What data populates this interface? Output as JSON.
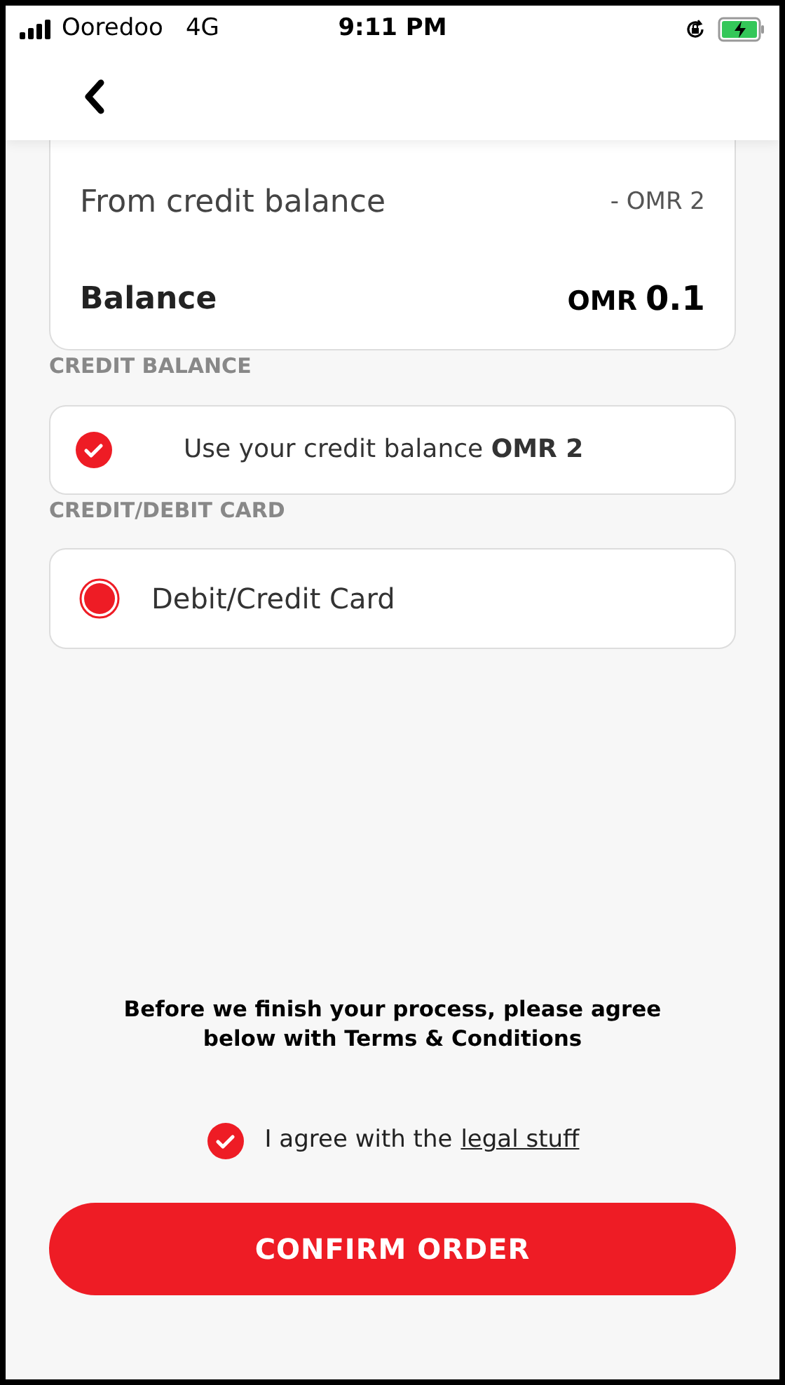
{
  "status_bar": {
    "carrier": "Ooredoo",
    "network": "4G",
    "time": "9:11 PM"
  },
  "summary": {
    "rows": [
      {
        "kind": "line",
        "label": "From credit balance",
        "value": "- OMR 2"
      },
      {
        "kind": "total",
        "label": "Balance",
        "currency": "OMR",
        "value": "0.1"
      }
    ]
  },
  "sections": [
    {
      "heading": "CREDIT BALANCE",
      "option": {
        "kind": "checkbox",
        "checked": true,
        "text": "Use your credit balance **OMR 2**"
      }
    },
    {
      "heading": "CREDIT/DEBIT CARD",
      "option": {
        "kind": "radio",
        "selected": true,
        "text": "Debit/Credit Card"
      }
    }
  ],
  "terms": {
    "notice": "Before we finish your process, please agree below with Terms & Conditions",
    "agree": {
      "checked": true,
      "text": "I agree with the",
      "link": "legal stuff"
    }
  },
  "confirm_button": "CONFIRM ORDER"
}
